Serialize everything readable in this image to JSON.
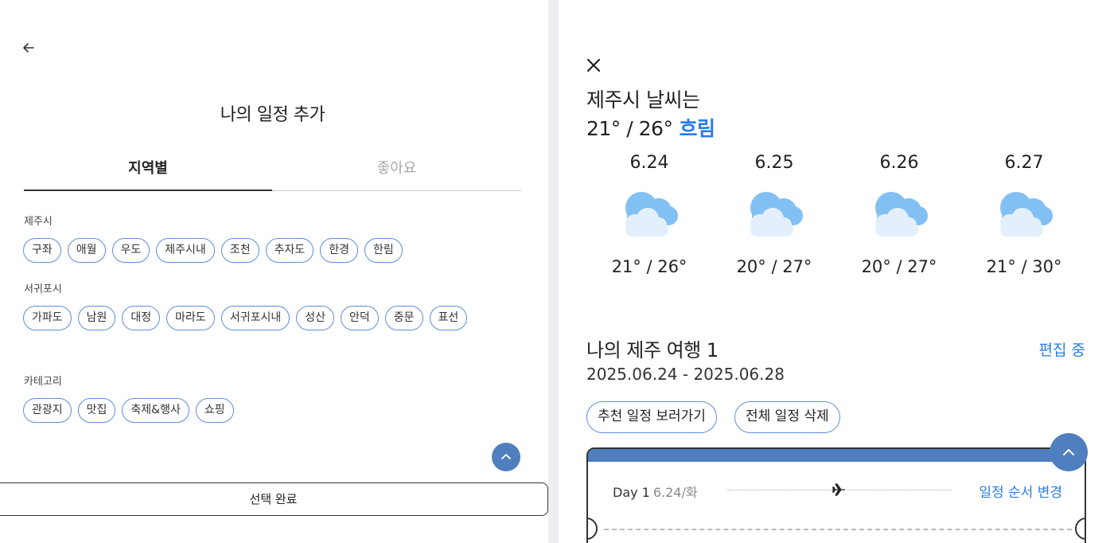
{
  "left": {
    "title": "나의 일정 추가",
    "tabs": [
      {
        "label": "지역별",
        "active": true
      },
      {
        "label": "좋아요",
        "active": false
      }
    ],
    "sections": [
      {
        "label": "제주시",
        "chips": [
          "구좌",
          "애월",
          "우도",
          "제주시내",
          "조천",
          "추자도",
          "한경",
          "한림"
        ]
      },
      {
        "label": "서귀포시",
        "chips": [
          "가파도",
          "남원",
          "대정",
          "마라도",
          "서귀포시내",
          "성산",
          "안덕",
          "중문",
          "표선"
        ]
      },
      {
        "label": "카테고리",
        "chips": [
          "관광지",
          "맛집",
          "축제&행사",
          "쇼핑"
        ]
      }
    ],
    "done_label": "선택 완료",
    "icons": {
      "back": "arrow-left-icon",
      "scroll_top": "chevron-up-icon"
    }
  },
  "right": {
    "weather": {
      "heading": "제주시 날씨는",
      "temp": "21° / 26°",
      "condition": "흐림",
      "forecast": [
        {
          "date": "6.24",
          "range": "21° / 26°",
          "icon": "cloud-icon"
        },
        {
          "date": "6.25",
          "range": "20° / 27°",
          "icon": "cloud-icon"
        },
        {
          "date": "6.26",
          "range": "20° / 27°",
          "icon": "cloud-icon"
        },
        {
          "date": "6.27",
          "range": "21° / 30°",
          "icon": "cloud-icon"
        }
      ]
    },
    "trip": {
      "title": "나의 제주 여행 1",
      "dates": "2025.06.24 - 2025.06.28",
      "edit_label": "편집 중",
      "buttons": [
        "추천 일정 보러가기",
        "전체 일정 삭제"
      ]
    },
    "day_card": {
      "day": "Day 1",
      "date": "6.24/화",
      "reorder_label": "일정 순서 변경"
    }
  },
  "colors": {
    "accent_blue": "#2a7be4",
    "chip_border": "#5b8ed4",
    "header_blue": "#4f7fbe",
    "divider": "#eceef1"
  }
}
